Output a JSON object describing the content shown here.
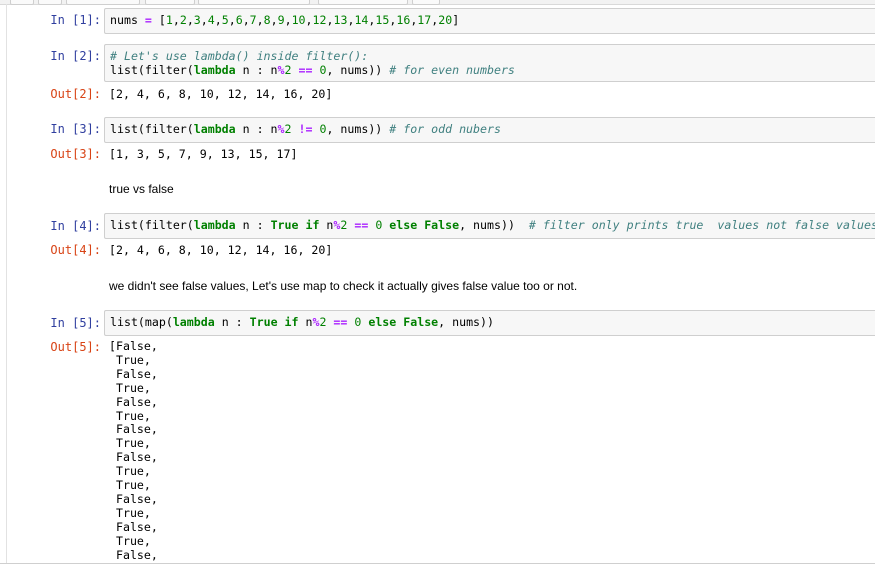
{
  "cells": {
    "c1": {
      "prompt": "In [1]:",
      "line1": [
        {
          "t": "nums ",
          "c": "pn"
        },
        {
          "t": "=",
          "c": "op"
        },
        {
          "t": " [",
          "c": "pn"
        },
        {
          "t": "1",
          "c": "num"
        },
        {
          "t": ",",
          "c": "pn"
        },
        {
          "t": "2",
          "c": "num"
        },
        {
          "t": ",",
          "c": "pn"
        },
        {
          "t": "3",
          "c": "num"
        },
        {
          "t": ",",
          "c": "pn"
        },
        {
          "t": "4",
          "c": "num"
        },
        {
          "t": ",",
          "c": "pn"
        },
        {
          "t": "5",
          "c": "num"
        },
        {
          "t": ",",
          "c": "pn"
        },
        {
          "t": "6",
          "c": "num"
        },
        {
          "t": ",",
          "c": "pn"
        },
        {
          "t": "7",
          "c": "num"
        },
        {
          "t": ",",
          "c": "pn"
        },
        {
          "t": "8",
          "c": "num"
        },
        {
          "t": ",",
          "c": "pn"
        },
        {
          "t": "9",
          "c": "num"
        },
        {
          "t": ",",
          "c": "pn"
        },
        {
          "t": "10",
          "c": "num"
        },
        {
          "t": ",",
          "c": "pn"
        },
        {
          "t": "12",
          "c": "num"
        },
        {
          "t": ",",
          "c": "pn"
        },
        {
          "t": "13",
          "c": "num"
        },
        {
          "t": ",",
          "c": "pn"
        },
        {
          "t": "14",
          "c": "num"
        },
        {
          "t": ",",
          "c": "pn"
        },
        {
          "t": "15",
          "c": "num"
        },
        {
          "t": ",",
          "c": "pn"
        },
        {
          "t": "16",
          "c": "num"
        },
        {
          "t": ",",
          "c": "pn"
        },
        {
          "t": "17",
          "c": "num"
        },
        {
          "t": ",",
          "c": "pn"
        },
        {
          "t": "20",
          "c": "num"
        },
        {
          "t": "]",
          "c": "pn"
        }
      ]
    },
    "c2": {
      "prompt": "In [2]:",
      "line1": [
        {
          "t": "# Let's use lambda() inside filter():",
          "c": "cm"
        }
      ],
      "line2": [
        {
          "t": "list(filter(",
          "c": "pn"
        },
        {
          "t": "lambda",
          "c": "kw"
        },
        {
          "t": " n : n",
          "c": "pn"
        },
        {
          "t": "%",
          "c": "op"
        },
        {
          "t": "2",
          "c": "num"
        },
        {
          "t": " ",
          "c": "pn"
        },
        {
          "t": "==",
          "c": "op"
        },
        {
          "t": " ",
          "c": "pn"
        },
        {
          "t": "0",
          "c": "num"
        },
        {
          "t": ", nums)) ",
          "c": "pn"
        },
        {
          "t": "# for even numbers",
          "c": "cm"
        }
      ],
      "out_prompt": "Out[2]:",
      "output": "[2, 4, 6, 8, 10, 12, 14, 16, 20]"
    },
    "c3": {
      "prompt": "In [3]:",
      "line1": [
        {
          "t": "list(filter(",
          "c": "pn"
        },
        {
          "t": "lambda",
          "c": "kw"
        },
        {
          "t": " n : n",
          "c": "pn"
        },
        {
          "t": "%",
          "c": "op"
        },
        {
          "t": "2",
          "c": "num"
        },
        {
          "t": " ",
          "c": "pn"
        },
        {
          "t": "!=",
          "c": "op"
        },
        {
          "t": " ",
          "c": "pn"
        },
        {
          "t": "0",
          "c": "num"
        },
        {
          "t": ", nums)) ",
          "c": "pn"
        },
        {
          "t": "# for odd nubers",
          "c": "cm"
        }
      ],
      "out_prompt": "Out[3]:",
      "output": "[1, 3, 5, 7, 9, 13, 15, 17]"
    },
    "md1": "true vs false",
    "c4": {
      "prompt": "In [4]:",
      "line1": [
        {
          "t": "list(filter(",
          "c": "pn"
        },
        {
          "t": "lambda",
          "c": "kw"
        },
        {
          "t": " n : ",
          "c": "pn"
        },
        {
          "t": "True",
          "c": "kw"
        },
        {
          "t": " ",
          "c": "pn"
        },
        {
          "t": "if",
          "c": "kw"
        },
        {
          "t": " n",
          "c": "pn"
        },
        {
          "t": "%",
          "c": "op"
        },
        {
          "t": "2",
          "c": "num"
        },
        {
          "t": " ",
          "c": "pn"
        },
        {
          "t": "==",
          "c": "op"
        },
        {
          "t": " ",
          "c": "pn"
        },
        {
          "t": "0",
          "c": "num"
        },
        {
          "t": " ",
          "c": "pn"
        },
        {
          "t": "else",
          "c": "kw"
        },
        {
          "t": " ",
          "c": "pn"
        },
        {
          "t": "False",
          "c": "kw"
        },
        {
          "t": ", nums))  ",
          "c": "pn"
        },
        {
          "t": "# filter only prints true  values not false values.",
          "c": "cm"
        }
      ],
      "out_prompt": "Out[4]:",
      "output": "[2, 4, 6, 8, 10, 12, 14, 16, 20]"
    },
    "md2": "we didn't see false values, Let's use map to check it actually gives false value too or not.",
    "c5": {
      "prompt": "In [5]:",
      "line1": [
        {
          "t": "list(map(",
          "c": "pn"
        },
        {
          "t": "lambda",
          "c": "kw"
        },
        {
          "t": " n : ",
          "c": "pn"
        },
        {
          "t": "True",
          "c": "kw"
        },
        {
          "t": " ",
          "c": "pn"
        },
        {
          "t": "if",
          "c": "kw"
        },
        {
          "t": " n",
          "c": "pn"
        },
        {
          "t": "%",
          "c": "op"
        },
        {
          "t": "2",
          "c": "num"
        },
        {
          "t": " ",
          "c": "pn"
        },
        {
          "t": "==",
          "c": "op"
        },
        {
          "t": " ",
          "c": "pn"
        },
        {
          "t": "0",
          "c": "num"
        },
        {
          "t": " ",
          "c": "pn"
        },
        {
          "t": "else",
          "c": "kw"
        },
        {
          "t": " ",
          "c": "pn"
        },
        {
          "t": "False",
          "c": "kw"
        },
        {
          "t": ", nums))",
          "c": "pn"
        }
      ],
      "out_prompt": "Out[5]:",
      "output_lines": [
        "[False,",
        " True,",
        " False,",
        " True,",
        " False,",
        " True,",
        " False,",
        " True,",
        " False,",
        " True,",
        " True,",
        " False,",
        " True,",
        " False,",
        " True,",
        " False,"
      ]
    }
  },
  "colors": {
    "in_prompt": "#303f9f",
    "out_prompt": "#d84315",
    "keyword": "#008000",
    "number": "#008000",
    "operator": "#aa22ff",
    "comment": "#408080",
    "cell_bg": "#f7f7f7"
  }
}
